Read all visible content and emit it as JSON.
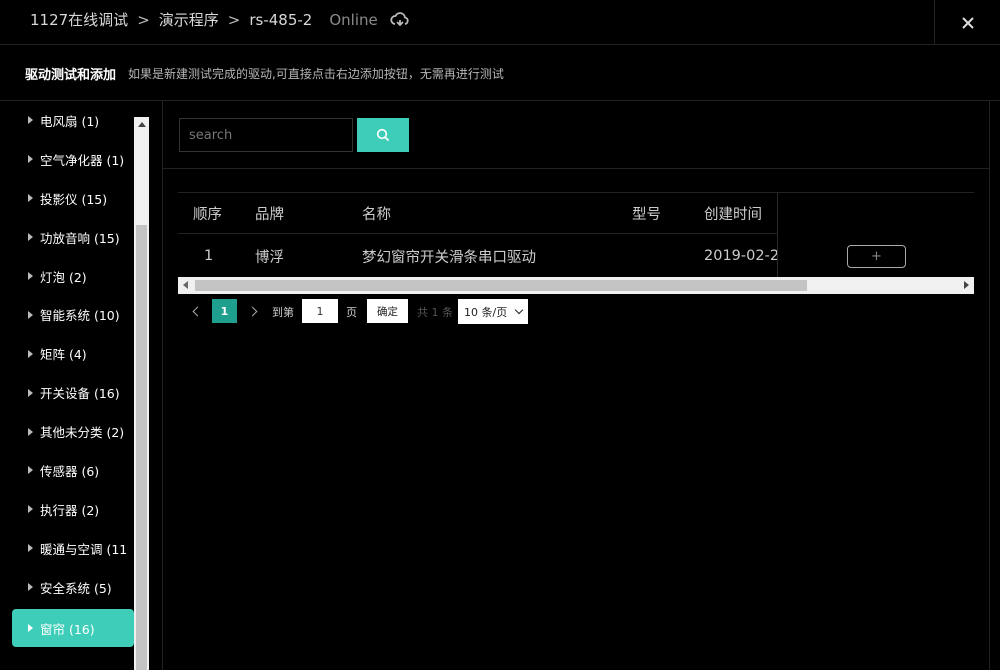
{
  "header": {
    "breadcrumb": [
      "1127在线调试",
      "演示程序",
      "rs-485-2"
    ],
    "separator": ">",
    "status": "Online",
    "status_icon": "cloud-sync-icon",
    "close_icon": "close-icon"
  },
  "infobar": {
    "title": "驱动测试和添加",
    "description": "如果是新建测试完成的驱动,可直接点击右边添加按钮，无需再进行测试"
  },
  "sidebar": {
    "items": [
      {
        "label": "电风扇 (1)"
      },
      {
        "label": "空气净化器 (1)"
      },
      {
        "label": "投影仪 (15)"
      },
      {
        "label": "功放音响 (15)"
      },
      {
        "label": "灯泡 (2)"
      },
      {
        "label": "智能系统 (10)"
      },
      {
        "label": "矩阵 (4)"
      },
      {
        "label": "开关设备 (16)"
      },
      {
        "label": "其他未分类 (2)"
      },
      {
        "label": "传感器 (6)"
      },
      {
        "label": "执行器 (2)"
      },
      {
        "label": "暖通与空调 (11"
      },
      {
        "label": "安全系统 (5)"
      },
      {
        "label": "窗帘 (16)"
      }
    ],
    "active_index": 13
  },
  "search": {
    "placeholder": "search",
    "value": "",
    "button_icon": "search-icon",
    "accent_color": "#3ecdb8"
  },
  "table": {
    "columns": [
      "顺序",
      "品牌",
      "名称",
      "型号",
      "创建时间"
    ],
    "rows": [
      {
        "index": "1",
        "brand": "博浮",
        "name": "梦幻窗帘开关滑条串口驱动",
        "model": "",
        "created": "2019-02-2",
        "action": "+"
      }
    ]
  },
  "pagination": {
    "current_page": "1",
    "goto_label": "到第",
    "goto_value": "1",
    "page_label": "页",
    "confirm_label": "确定",
    "total_label": "共 1 条",
    "page_size": "10 条/页"
  }
}
